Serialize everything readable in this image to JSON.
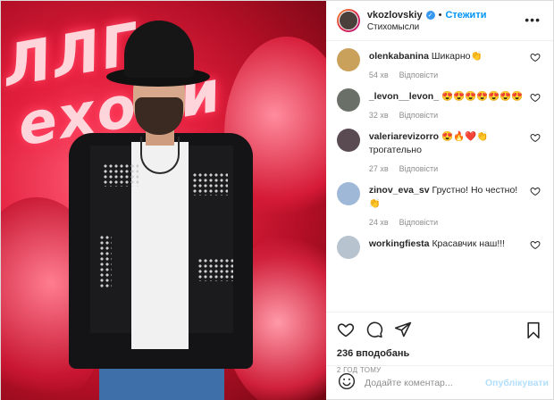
{
  "header": {
    "username": "vkozlovskiy",
    "verified_icon": "verified-badge-icon",
    "separator": "•",
    "follow_label": "Стежити",
    "location": "Стихомысли",
    "more_icon": "more-options-icon"
  },
  "photo": {
    "neon_line1": "ЛЛГ",
    "neon_line2": "ехоли"
  },
  "comments": [
    {
      "user": "olenkabanina",
      "text": "Шикарно👏",
      "time": "54 хв",
      "reply": "Відповісти",
      "avatar_color": "#c9a15a"
    },
    {
      "user": "_levon__levon_",
      "text": "😍😍😍😍😍😍😍",
      "time": "32 хв",
      "reply": "Відповісти",
      "avatar_color": "#6a7068"
    },
    {
      "user": "valeriarevizorro",
      "text": "😍🔥❤️👏 трогательно",
      "time": "27 хв",
      "reply": "Відповісти",
      "avatar_color": "#5a4a52"
    },
    {
      "user": "zinov_eva_sv",
      "text": "Грустно! Но честно!👏",
      "time": "24 хв",
      "reply": "Відповісти",
      "avatar_color": "#9fb8d8"
    },
    {
      "user": "workingfiesta",
      "text": "Красавчик наш!!!",
      "time": "",
      "reply": "",
      "avatar_color": "#b7c3cf"
    }
  ],
  "actions": {
    "like_icon": "heart-icon",
    "comment_icon": "comment-icon",
    "share_icon": "share-icon",
    "save_icon": "bookmark-icon",
    "likes": "236 вподобань",
    "time_ago": "2 ГОД ТОМУ"
  },
  "add_comment": {
    "emoji_icon": "emoji-icon",
    "placeholder": "Додайте коментар...",
    "publish_label": "Опублікувати"
  },
  "colors": {
    "accent": "#0095f6",
    "publish_disabled": "#b2dffc",
    "muted": "#8e8e8e"
  }
}
